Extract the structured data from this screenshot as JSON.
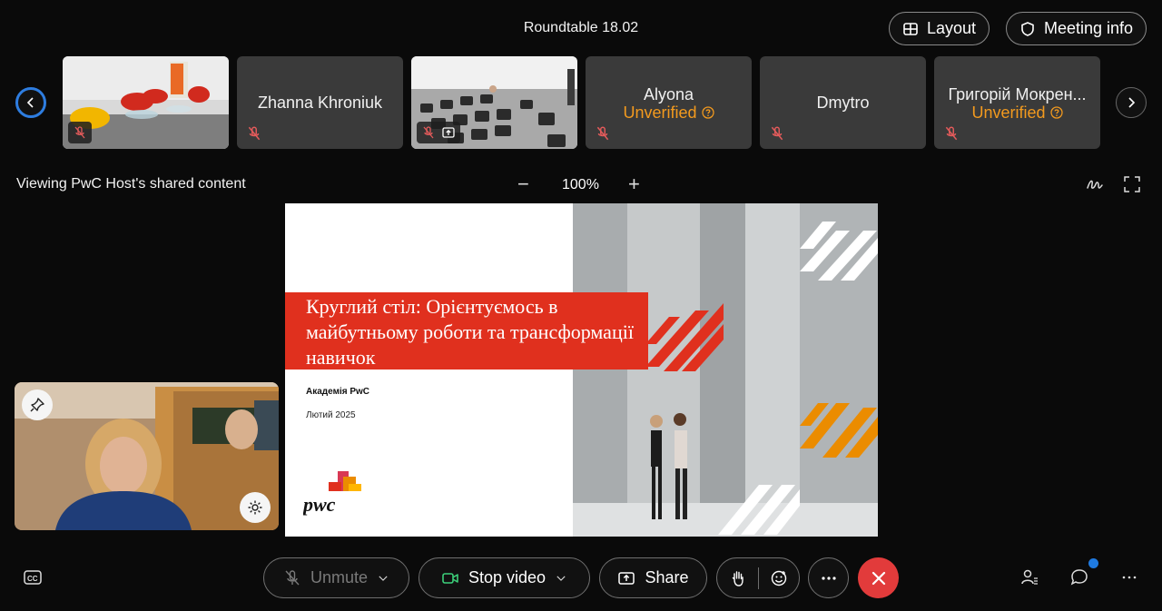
{
  "header": {
    "meeting_title": "Roundtable 18.02",
    "layout_label": "Layout",
    "meeting_info_label": "Meeting info"
  },
  "participants": [
    {
      "name": "",
      "type": "video"
    },
    {
      "name": "Zhanna Khroniuk",
      "type": "avatar"
    },
    {
      "name": "",
      "type": "video",
      "sharing": true
    },
    {
      "name": "Alyona",
      "status": "Unverified",
      "type": "avatar"
    },
    {
      "name": "Dmytro",
      "type": "avatar"
    },
    {
      "name": "Григорій Мокрен...",
      "status": "Unverified",
      "type": "avatar"
    }
  ],
  "share": {
    "label": "Viewing PwC Host's shared content",
    "zoom_minus": "−",
    "zoom_level": "100%",
    "zoom_plus": "+"
  },
  "slide": {
    "title": "Круглий стіл: Орієнтуємось в майбутньому роботи та трансформації навичок",
    "subtitle": "Академія PwC",
    "date": "Лютий 2025",
    "logo_text": "pwc"
  },
  "controls": {
    "unmute_label": "Unmute",
    "stop_video_label": "Stop video",
    "share_label": "Share"
  },
  "colors": {
    "accent_blue": "#2e7de0",
    "unverified_orange": "#f39a1e",
    "hangup_red": "#e23b3b",
    "pwc_red": "#e0301e"
  }
}
